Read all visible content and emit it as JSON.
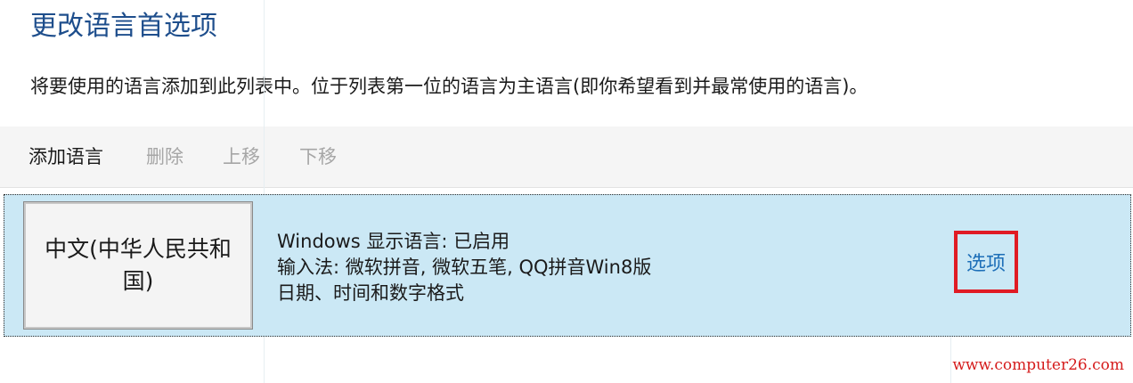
{
  "header": {
    "title": "更改语言首选项",
    "description": "将要使用的语言添加到此列表中。位于列表第一位的语言为主语言(即你希望看到并最常使用的语言)。"
  },
  "toolbar": {
    "add_label": "添加语言",
    "delete_label": "删除",
    "move_up_label": "上移",
    "move_down_label": "下移"
  },
  "languages": [
    {
      "name": "中文(中华人民共和国)",
      "details": [
        "Windows 显示语言: 已启用",
        "输入法: 微软拼音, 微软五笔, QQ拼音Win8版",
        "日期、时间和数字格式"
      ],
      "options_label": "选项"
    }
  ],
  "watermark": "www.computer26.com",
  "colors": {
    "title": "#1e4e8c",
    "selected_row": "#cbe8f5",
    "link": "#1d6fb8",
    "highlight_box": "#e01b24",
    "disabled_text": "#a6a6a6"
  }
}
